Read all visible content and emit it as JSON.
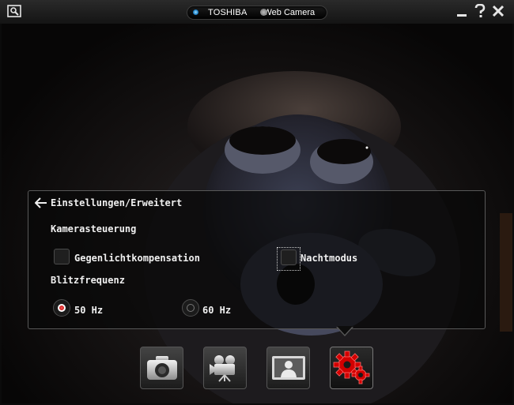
{
  "titlebar": {
    "brand": "TOSHIBA",
    "app_name": "Web Camera",
    "icons": [
      "screen-capture-icon",
      "minimize-icon",
      "help-icon",
      "close-icon"
    ]
  },
  "settings": {
    "breadcrumb": "Einstellungen/Erweitert",
    "camera_control": {
      "heading": "Kamerasteuerung",
      "backlight_label": "Gegenlichtkompensation",
      "backlight_checked": false,
      "night_mode_label": "Nachtmodus",
      "night_mode_checked": false
    },
    "flicker": {
      "heading": "Blitzfrequenz",
      "options": [
        "50 Hz",
        "60 Hz"
      ],
      "selected": "50 Hz"
    }
  },
  "toolbar": {
    "buttons": [
      "photo-camera-icon",
      "video-camera-icon",
      "effects-icon",
      "settings-gears-icon"
    ],
    "active": "settings-gears-icon"
  },
  "colors": {
    "accent": "#d20000",
    "panel_border": "#585858",
    "selection_blue": "#1c7fc7"
  }
}
